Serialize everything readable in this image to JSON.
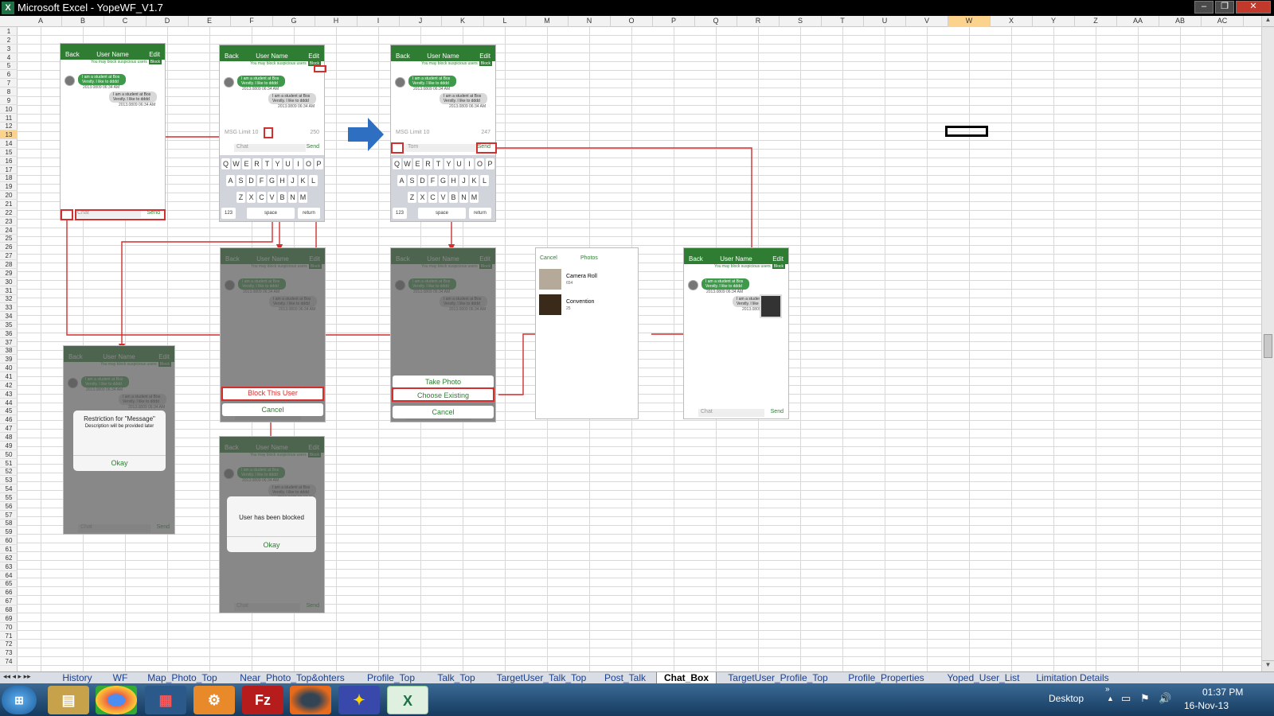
{
  "window": {
    "title": "Microsoft Excel - YopeWF_V1.7",
    "app_icon": "excel-icon"
  },
  "columns": [
    "A",
    "B",
    "C",
    "D",
    "E",
    "F",
    "G",
    "H",
    "I",
    "J",
    "K",
    "L",
    "M",
    "N",
    "O",
    "P",
    "Q",
    "R",
    "S",
    "T",
    "U",
    "V",
    "W",
    "X",
    "Y",
    "Z",
    "AA",
    "AB",
    "AC"
  ],
  "selected_column": "W",
  "selected_row": "13",
  "sheet_tabs": [
    "History",
    "WF",
    "Map_Photo_Top",
    "Near_Photo_Top&ohters",
    "Profile_Top",
    "Talk_Top",
    "TargetUser_Talk_Top",
    "Post_Talk",
    "Chat_Box",
    "TargetUser_Profile_Top",
    "Profile_Properties",
    "Yoped_User_List",
    "Limitation Details"
  ],
  "active_tab": "Chat_Box",
  "taskbar": {
    "desktop_label": "Desktop",
    "time": "01:37 PM",
    "date": "16-Nov-13"
  },
  "mock": {
    "header_back": "Back",
    "header_title": "User Name",
    "header_edit": "Edit",
    "warning": "You may block suspicious users",
    "block": "Block",
    "msg_in": "I am a student at Bos Verstly. I like to dddd",
    "msg_out": "I am a student at Bos Verstly. I like to dddd",
    "timestamp": "2013.0809 06:34 AM",
    "chat_placeholder": "Chat",
    "send": "Send",
    "msg_limit": "MSG Limit 10",
    "count_a": "250",
    "count_b": "247",
    "typed": "Tom",
    "block_user": "Block This User",
    "cancel": "Cancel",
    "blocked_msg": "User has been blocked",
    "okay": "Okay",
    "restriction_title": "Restriction for \"Message\"",
    "restriction_desc": "Description will be provided later",
    "take_photo": "Take Photo",
    "choose_existing": "Choose Existing",
    "photos_cancel": "Cancel",
    "photos_title": "Photos",
    "album1": "Camera Roll",
    "album1_count": "654",
    "album2": "Convention",
    "album2_count": "25",
    "keys_row1": [
      "Q",
      "W",
      "E",
      "R",
      "T",
      "Y",
      "U",
      "I",
      "O",
      "P"
    ],
    "keys_row2": [
      "A",
      "S",
      "D",
      "F",
      "G",
      "H",
      "J",
      "K",
      "L"
    ],
    "keys_row3": [
      "Z",
      "X",
      "C",
      "V",
      "B",
      "N",
      "M"
    ],
    "key_123": "123",
    "key_space": "space",
    "key_return": "return"
  },
  "colors": {
    "accent": "#2e7d32",
    "arrow": "#d32f2f",
    "flow_arrow": "#2f6fc1"
  }
}
